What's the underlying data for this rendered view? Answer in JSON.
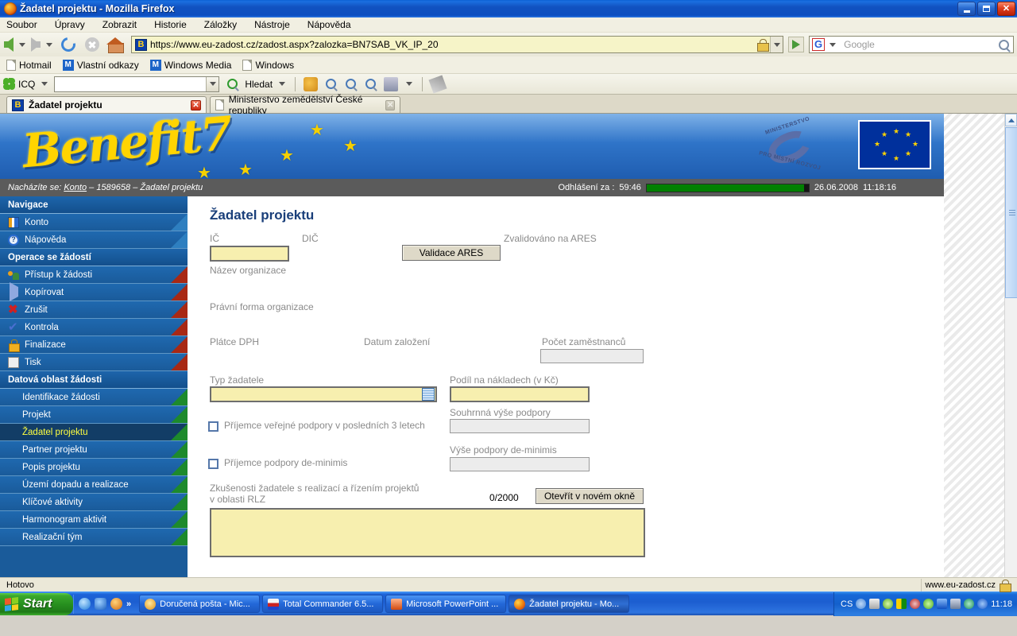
{
  "window": {
    "title": "Žadatel projektu - Mozilla Firefox",
    "minimize": "_",
    "maximize": "□",
    "close": "×"
  },
  "menu": [
    "Soubor",
    "Úpravy",
    "Zobrazit",
    "Historie",
    "Záložky",
    "Nástroje",
    "Nápověda"
  ],
  "toolbar": {
    "url": "https://www.eu-zadost.cz/zadost.aspx?zalozka=BN7SAB_VK_IP_20",
    "url_badge": "B",
    "search_placeholder": "Google",
    "search_value": ""
  },
  "bookmarks": [
    {
      "label": "Hotmail",
      "icon": "page-icon"
    },
    {
      "label": "Vlastní odkazy",
      "icon": "msn-icon"
    },
    {
      "label": "Windows Media",
      "icon": "msn-icon"
    },
    {
      "label": "Windows",
      "icon": "page-icon"
    }
  ],
  "icq_toolbar": {
    "label": "ICQ",
    "input_value": "",
    "search_label": "Hledat"
  },
  "tabs": [
    {
      "label": "Žadatel projektu",
      "active": true,
      "icon": "benefit-icon"
    },
    {
      "label": "Ministerstvo zemědělství České republiky",
      "active": false,
      "icon": "page-icon"
    }
  ],
  "banner": {
    "logo_text": "Benefit7",
    "ministry_line1": "MINISTERSTVO",
    "ministry_line2": "PRO MÍSTNÍ ROZVOJ"
  },
  "infobar": {
    "prefix": "Nacházíte se:",
    "crumb_link": "Konto",
    "crumb_rest": "– 1589658 – Žadatel projektu",
    "logout_label": "Odhlášení za :",
    "logout_time": "59:46",
    "date": "26.06.2008",
    "time": "11:18:16"
  },
  "sidebar": {
    "groups": [
      {
        "title": "Navigace",
        "items": [
          {
            "label": "Konto",
            "icon": "konto-icon",
            "corner": "blue",
            "active": false
          },
          {
            "label": "Nápověda",
            "icon": "help-icon",
            "corner": "blue",
            "active": false
          }
        ]
      },
      {
        "title": "Operace se žádostí",
        "items": [
          {
            "label": "Přístup k žádosti",
            "icon": "users-icon",
            "corner": "red",
            "active": false
          },
          {
            "label": "Kopírovat",
            "icon": "copy-icon",
            "corner": "red",
            "active": false
          },
          {
            "label": "Zrušit",
            "icon": "cancel-icon",
            "corner": "red",
            "active": false
          },
          {
            "label": "Kontrola",
            "icon": "check-icon",
            "corner": "red",
            "active": false
          },
          {
            "label": "Finalizace",
            "icon": "lock-icon",
            "corner": "red",
            "active": false
          },
          {
            "label": "Tisk",
            "icon": "print-icon",
            "corner": "red",
            "active": false
          }
        ]
      },
      {
        "title": "Datová oblast žádosti",
        "items": [
          {
            "label": "Identifikace žádosti",
            "icon": "",
            "corner": "green",
            "active": false
          },
          {
            "label": "Projekt",
            "icon": "",
            "corner": "green",
            "active": false
          },
          {
            "label": "Žadatel projektu",
            "icon": "",
            "corner": "green",
            "active": true
          },
          {
            "label": "Partner projektu",
            "icon": "",
            "corner": "green",
            "active": false
          },
          {
            "label": "Popis projektu",
            "icon": "",
            "corner": "green",
            "active": false
          },
          {
            "label": "Území dopadu a realizace",
            "icon": "",
            "corner": "green",
            "active": false
          },
          {
            "label": "Klíčové aktivity",
            "icon": "",
            "corner": "green",
            "active": false
          },
          {
            "label": "Harmonogram aktivit",
            "icon": "",
            "corner": "green",
            "active": false
          },
          {
            "label": "Realizační tým",
            "icon": "",
            "corner": "green",
            "active": false
          }
        ]
      }
    ]
  },
  "form": {
    "title": "Žadatel projektu",
    "ic_label": "IČ",
    "ic_value": "",
    "dic_label": "DIČ",
    "dic_value": "",
    "validace_ares_button": "Validace ARES",
    "zvalidovano_label": "Zvalidováno na ARES",
    "nazev_organizace_label": "Název organizace",
    "nazev_organizace_value": "",
    "pravni_forma_label": "Právní forma organizace",
    "pravni_forma_value": "",
    "platce_dph_label": "Plátce DPH",
    "datum_zalozeni_label": "Datum založení",
    "pocet_zamestnancu_label": "Počet zaměstnanců",
    "pocet_zamestnancu_value": "",
    "typ_zadatele_label": "Typ žadatele",
    "typ_zadatele_value": "",
    "podil_nakladech_label": "Podíl na nákladech (v Kč)",
    "podil_nakladech_value": "",
    "souhrnna_vyse_label": "Souhrnná výše podpory",
    "souhrnna_vyse_value": "",
    "prijemce_verejne_label": "Příjemce veřejné podpory v posledních 3 letech",
    "vyse_deminimis_label": "Výše podpory de-minimis",
    "vyse_deminimis_value": "",
    "prijemce_deminimis_label": "Příjemce podpory de-minimis",
    "zkusenosti_label_l1": "Zkušenosti žadatele s realizací a řízením projektů",
    "zkusenosti_label_l2": "v oblasti RLZ",
    "counter": "0/2000",
    "open_window_button": "Otevřít v novém okně",
    "zkusenosti_value": ""
  },
  "statusbar": {
    "text": "Hotovo",
    "site": "www.eu-zadost.cz"
  },
  "taskbar": {
    "start": "Start",
    "tasks": [
      {
        "label": "Doručená pošta - Mic...",
        "active": false
      },
      {
        "label": "Total Commander 6.5...",
        "active": false
      },
      {
        "label": "Microsoft PowerPoint ...",
        "active": false
      },
      {
        "label": "Žadatel projektu - Mo...",
        "active": true
      }
    ],
    "tray_lang": "CS",
    "tray_clock": "11:18"
  },
  "colors": {
    "accent_blue": "#1a5b9a",
    "active_item": "#123d66",
    "active_text": "#ffff40",
    "field_yellow": "#f7efaf",
    "progress_green": "#008000"
  }
}
